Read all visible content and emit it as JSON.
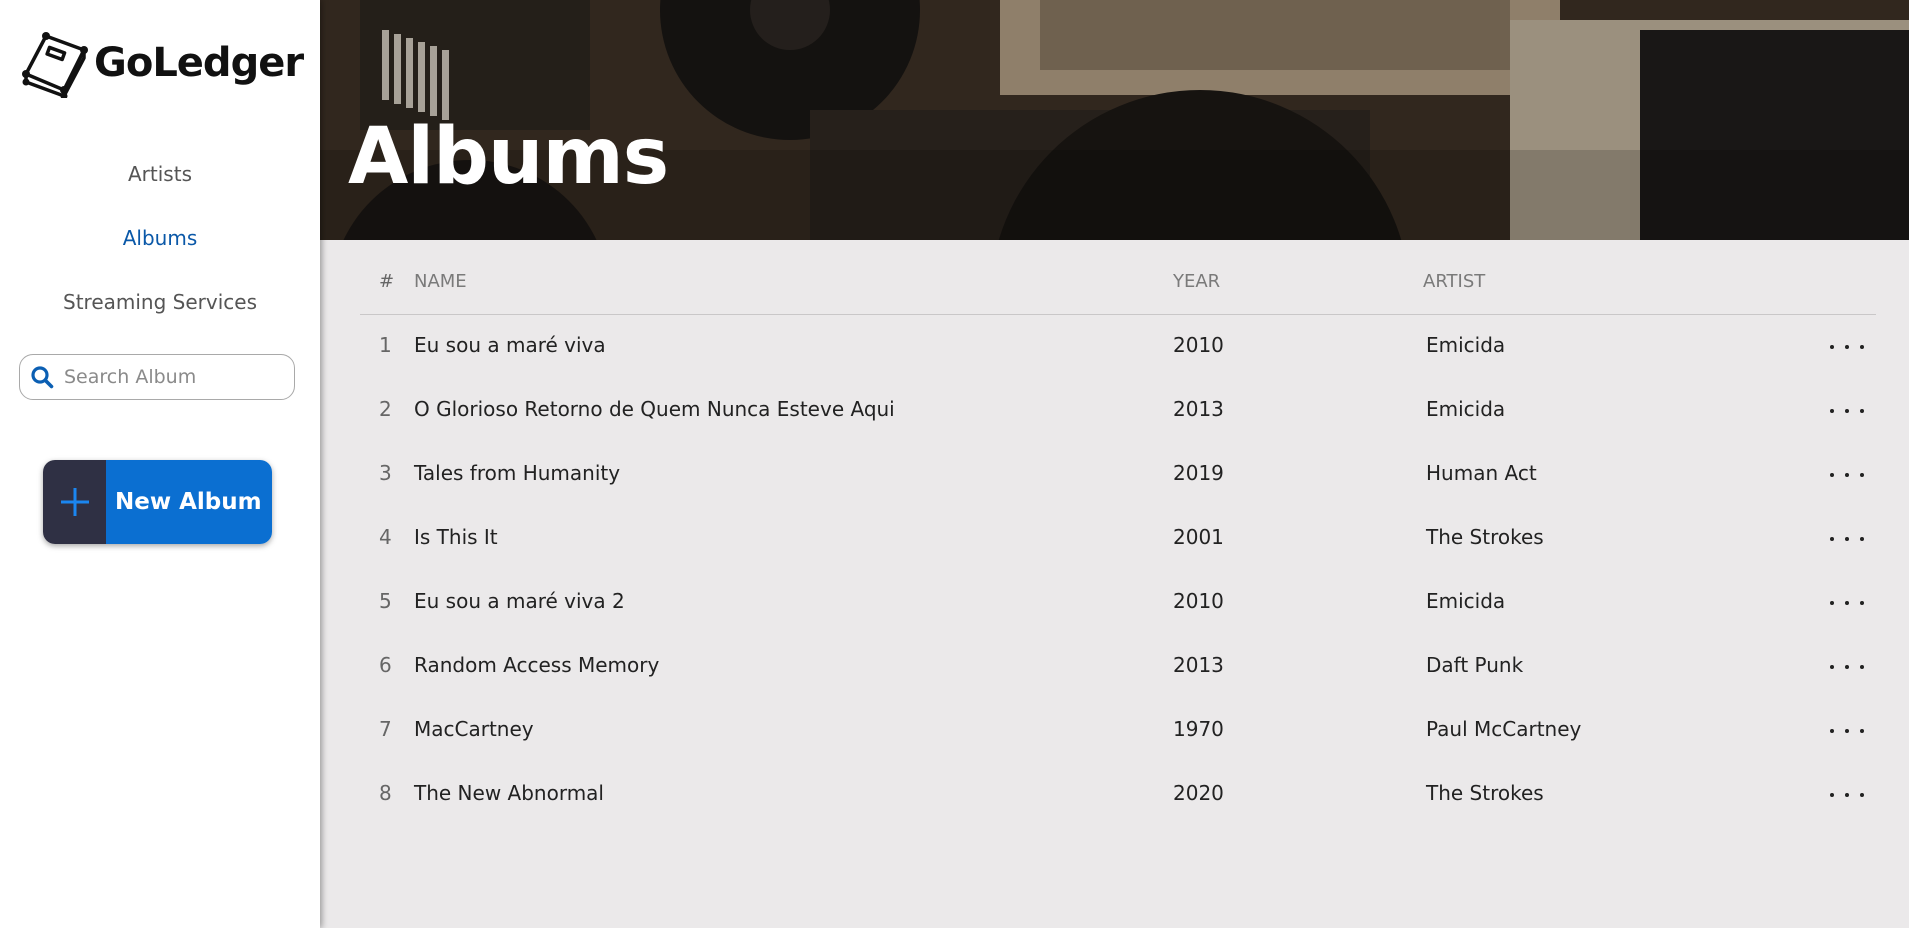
{
  "app": {
    "name": "GoLedger"
  },
  "sidebar": {
    "nav": [
      {
        "label": "Artists",
        "active": false
      },
      {
        "label": "Albums",
        "active": true
      },
      {
        "label": "Streaming Services",
        "active": false
      }
    ],
    "search": {
      "placeholder": "Search Album",
      "value": ""
    },
    "new_album_button": {
      "label": "New Album"
    }
  },
  "hero": {
    "title": "Albums"
  },
  "table": {
    "headers": {
      "num": "#",
      "name": "NAME",
      "year": "YEAR",
      "artist": "ARTIST"
    },
    "rows": [
      {
        "num": "1",
        "name": "Eu sou a maré viva",
        "year": "2010",
        "artist": "Emicida"
      },
      {
        "num": "2",
        "name": "O Glorioso Retorno de Quem Nunca Esteve Aqui",
        "year": "2013",
        "artist": "Emicida"
      },
      {
        "num": "3",
        "name": "Tales from Humanity",
        "year": "2019",
        "artist": "Human Act"
      },
      {
        "num": "4",
        "name": "Is This It",
        "year": "2001",
        "artist": "The Strokes"
      },
      {
        "num": "5",
        "name": "Eu sou a maré viva 2",
        "year": "2010",
        "artist": "Emicida"
      },
      {
        "num": "6",
        "name": "Random Access Memory",
        "year": "2013",
        "artist": "Daft Punk"
      },
      {
        "num": "7",
        "name": "MacCartney",
        "year": "1970",
        "artist": "Paul McCartney"
      },
      {
        "num": "8",
        "name": "The New Abnormal",
        "year": "2020",
        "artist": "The Strokes"
      }
    ]
  },
  "colors": {
    "accent": "#0b6fd1",
    "active_nav": "#0a58a8",
    "button_dark": "#2f3044",
    "content_bg": "#ebe9ea"
  }
}
